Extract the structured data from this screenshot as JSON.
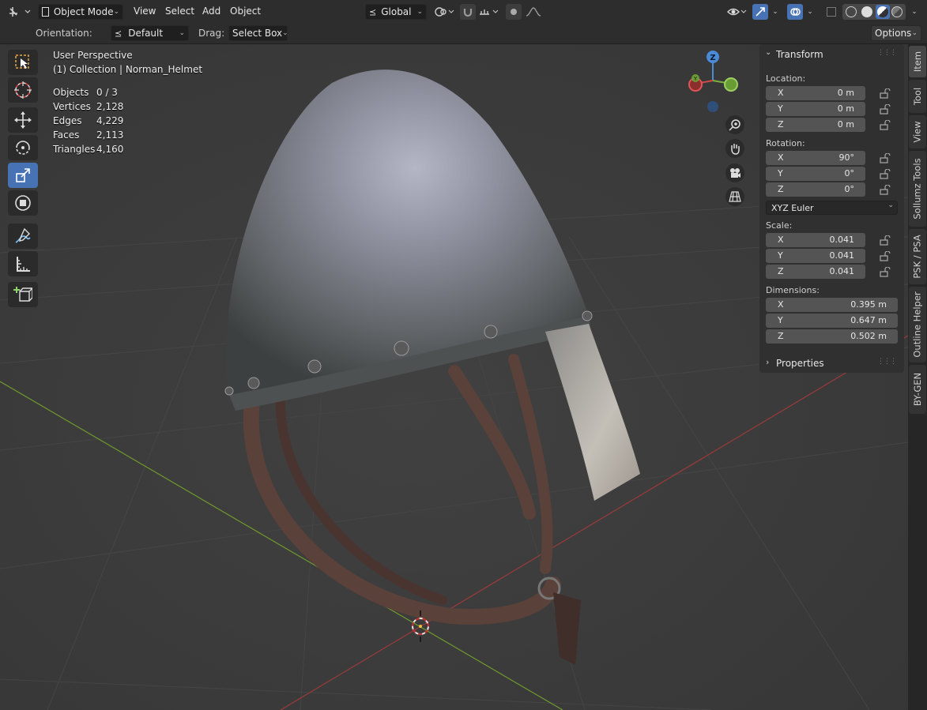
{
  "header": {
    "mode": "Object Mode",
    "menus": [
      "View",
      "Select",
      "Add",
      "Object"
    ],
    "transform_orientation": "Global"
  },
  "tool_header": {
    "orientation_label": "Orientation:",
    "orientation_value": "Default",
    "drag_label": "Drag:",
    "drag_value": "Select Box",
    "options_label": "Options"
  },
  "viewport": {
    "view_name": "User Perspective",
    "collection_line": "(1) Collection | Norman_Helmet",
    "stats": [
      {
        "label": "Objects",
        "value": "0 / 3"
      },
      {
        "label": "Vertices",
        "value": "2,128"
      },
      {
        "label": "Edges",
        "value": "4,229"
      },
      {
        "label": "Faces",
        "value": "2,113"
      },
      {
        "label": "Triangles",
        "value": "4,160"
      }
    ],
    "gizmo_z": "Z",
    "gizmo_y": "Y",
    "gizmo_x": "X"
  },
  "sidebar": {
    "transform_title": "Transform",
    "location_label": "Location:",
    "location": [
      {
        "axis": "X",
        "value": "0 m"
      },
      {
        "axis": "Y",
        "value": "0 m"
      },
      {
        "axis": "Z",
        "value": "0 m"
      }
    ],
    "rotation_label": "Rotation:",
    "rotation": [
      {
        "axis": "X",
        "value": "90°"
      },
      {
        "axis": "Y",
        "value": "0°"
      },
      {
        "axis": "Z",
        "value": "0°"
      }
    ],
    "rotation_mode": "XYZ Euler",
    "scale_label": "Scale:",
    "scale": [
      {
        "axis": "X",
        "value": "0.041"
      },
      {
        "axis": "Y",
        "value": "0.041"
      },
      {
        "axis": "Z",
        "value": "0.041"
      }
    ],
    "dimensions_label": "Dimensions:",
    "dimensions": [
      {
        "axis": "X",
        "value": "0.395 m"
      },
      {
        "axis": "Y",
        "value": "0.647 m"
      },
      {
        "axis": "Z",
        "value": "0.502 m"
      }
    ],
    "properties_title": "Properties",
    "tabs": [
      "Item",
      "Tool",
      "View",
      "Sollumz Tools",
      "PSK / PSA",
      "Outline Helper",
      "BY-GEN"
    ]
  }
}
